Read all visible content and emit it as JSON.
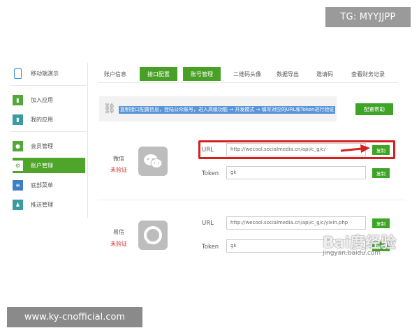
{
  "badges": {
    "tg": "TG: MYYJJPP",
    "site": "www.ky-cnofficial.com"
  },
  "sidebar": {
    "items": [
      {
        "label": "移动端演示",
        "icon": "phone-icon"
      },
      {
        "label": "加入应用",
        "icon": "bookmark-icon"
      },
      {
        "label": "我的应用",
        "icon": "bookmark-icon"
      },
      {
        "label": "会员管理",
        "icon": "users-icon"
      },
      {
        "label": "账户管理",
        "icon": "gear-icon",
        "active": true
      },
      {
        "label": "底部菜单",
        "icon": "menu-icon"
      },
      {
        "label": "推送管理",
        "icon": "user-icon"
      }
    ]
  },
  "tabs": [
    {
      "label": "账户信息"
    },
    {
      "label": "接口配置",
      "active": true
    },
    {
      "label": "账号管理",
      "active": true
    },
    {
      "label": "二维码头像"
    },
    {
      "label": "数据导出"
    },
    {
      "label": "邀请码"
    },
    {
      "label": "查看财务记录"
    }
  ],
  "banner": {
    "text": "复制接口配置信息，登陆公众账号，进入高级功能 → 开发模式 → 填写对应的URL和Token进行验证",
    "icon": "link-icon"
  },
  "help_button": "配置帮助",
  "accounts": [
    {
      "name": "微信",
      "status": "未验证",
      "logo": "wechat-icon",
      "url_label": "URL",
      "url_value": "http://wecool.socialmedia.cn/api/c_g/c/",
      "token_label": "Token",
      "token_value": "gk",
      "copy_label": "复制"
    },
    {
      "name": "易信",
      "status": "未验证",
      "logo": "yixin-icon",
      "url_label": "URL",
      "url_value": "http://wecool.socialmedia.cn/api/c_g/c/yixin.php",
      "token_label": "Token",
      "token_value": "gk",
      "copy_label": "复制"
    }
  ],
  "watermark": {
    "brand": "Bai度经验",
    "url": "jingyan.baidu.com"
  },
  "colors": {
    "accent": "#49a026",
    "highlight": "#d61f1f",
    "banner_text_bg": "#5b95d9"
  }
}
